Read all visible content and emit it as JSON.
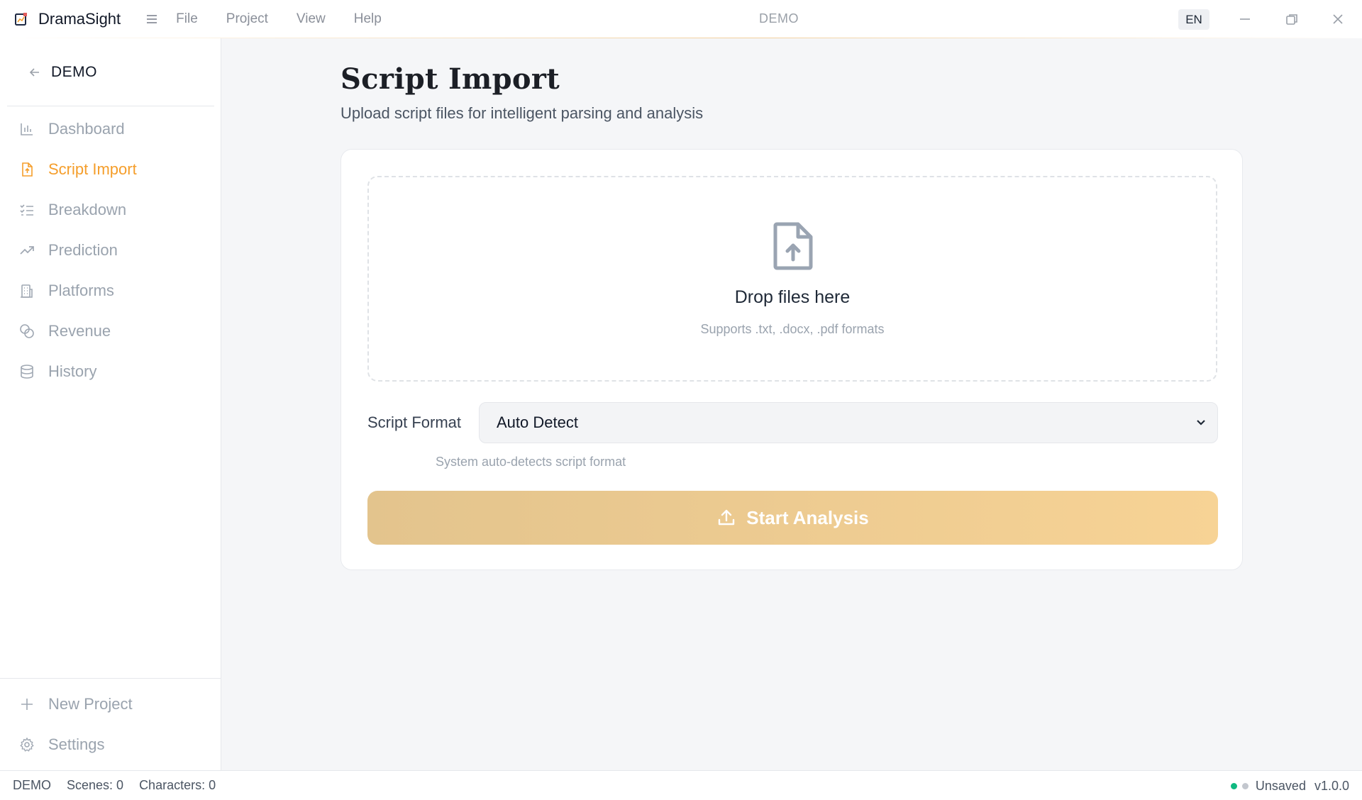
{
  "app": {
    "name": "DramaSight",
    "menu": [
      "File",
      "Project",
      "View",
      "Help"
    ],
    "window_title": "DEMO",
    "language": "EN"
  },
  "sidebar": {
    "project_name": "DEMO",
    "items": [
      {
        "label": "Dashboard",
        "icon": "bar-chart-icon",
        "active": false
      },
      {
        "label": "Script Import",
        "icon": "file-upload-icon",
        "active": true
      },
      {
        "label": "Breakdown",
        "icon": "checklist-icon",
        "active": false
      },
      {
        "label": "Prediction",
        "icon": "trending-up-icon",
        "active": false
      },
      {
        "label": "Platforms",
        "icon": "building-icon",
        "active": false
      },
      {
        "label": "Revenue",
        "icon": "coins-icon",
        "active": false
      },
      {
        "label": "History",
        "icon": "database-icon",
        "active": false
      }
    ],
    "bottom": [
      {
        "label": "New Project",
        "icon": "plus-icon"
      },
      {
        "label": "Settings",
        "icon": "gear-icon"
      }
    ]
  },
  "main": {
    "title": "Script Import",
    "subtitle": "Upload script files for intelligent parsing and analysis",
    "dropzone": {
      "title": "Drop files here",
      "subtitle": "Supports .txt, .docx, .pdf formats"
    },
    "format": {
      "label": "Script Format",
      "value": "Auto Detect",
      "hint": "System auto-detects script format"
    },
    "start_button": "Start Analysis"
  },
  "status": {
    "project": "DEMO",
    "scenes": "Scenes: 0",
    "characters": "Characters: 0",
    "save_state": "Unsaved",
    "version": "v1.0.0",
    "colors": {
      "ok": "#10b981",
      "idle": "#c3c7ce"
    }
  },
  "colors": {
    "accent": "#f59e2b",
    "button_start": "#e3c48d",
    "button_end": "#f7d395"
  }
}
